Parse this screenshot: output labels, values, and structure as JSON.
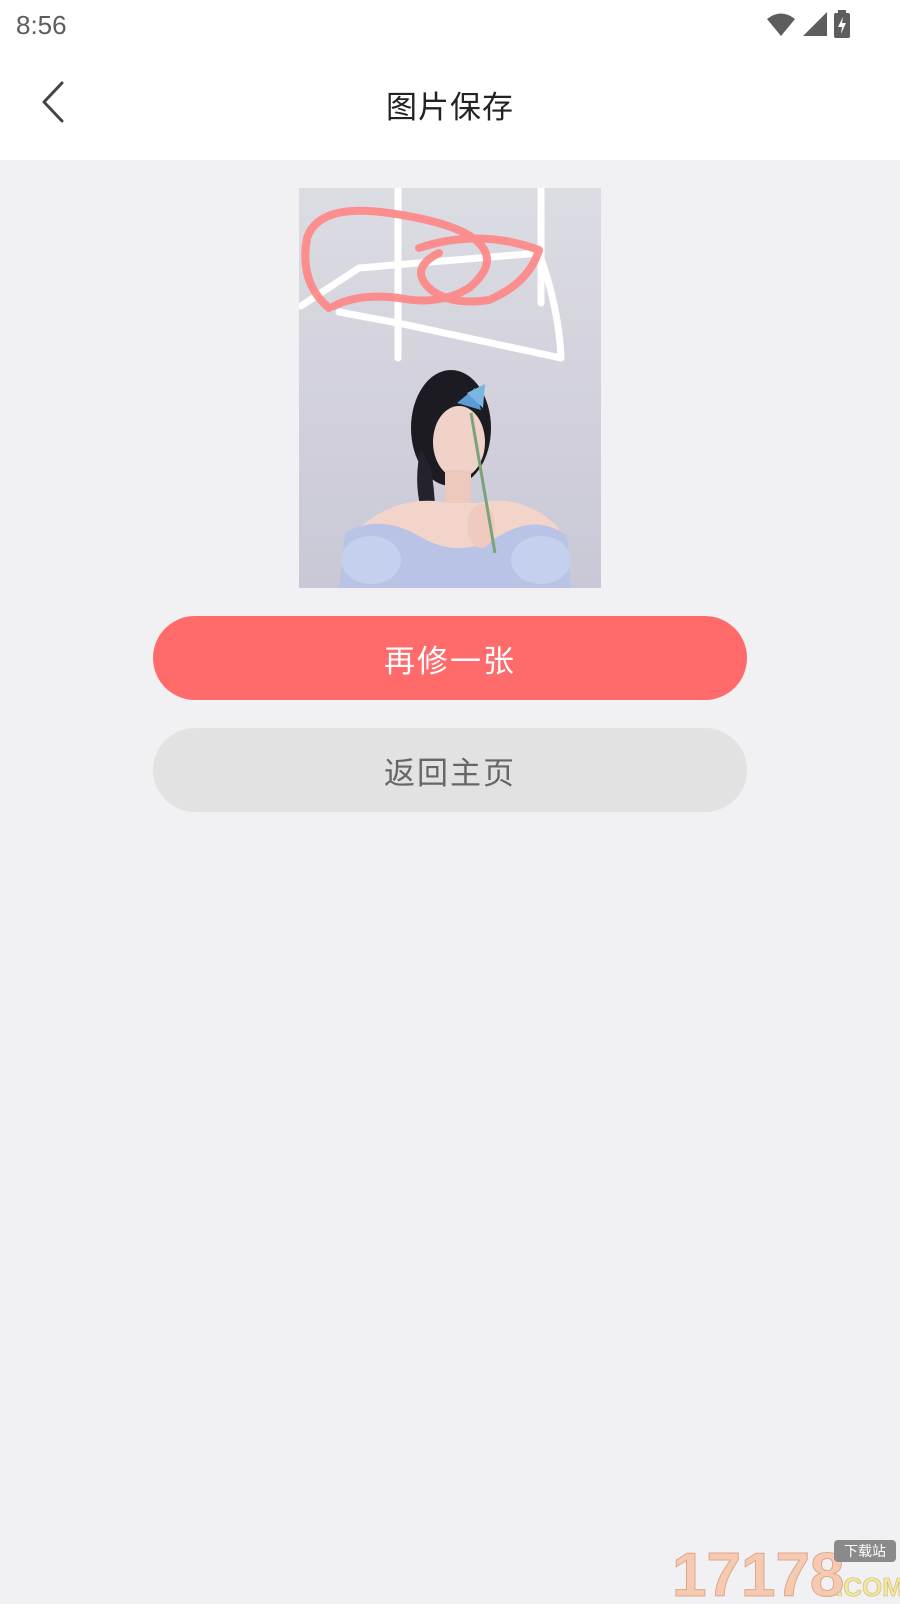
{
  "status_bar": {
    "time": "8:56",
    "icons": [
      "wifi-icon",
      "signal-icon",
      "battery-charging-icon"
    ]
  },
  "header": {
    "title": "图片保存",
    "back_icon": "chevron-left-icon"
  },
  "photo": {
    "description_icon": "saved-edited-photo"
  },
  "actions": {
    "edit_again_label": "再修一张",
    "back_home_label": "返回主页"
  },
  "watermark": {
    "text": "17178",
    "badge": "下载站",
    "domain": ".COM"
  },
  "colors": {
    "primary": "#ff6b6b",
    "secondary_bg": "#e2e2e2",
    "page_bg": "#f1f0f3"
  }
}
